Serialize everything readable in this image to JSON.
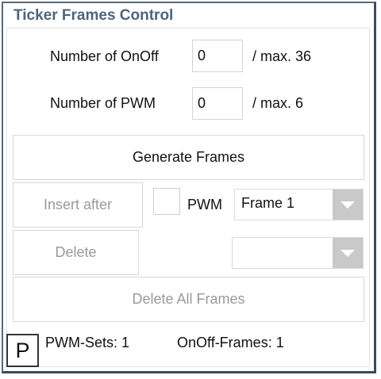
{
  "panel": {
    "title": "Ticker Frames Control"
  },
  "onoff": {
    "label": "Number of OnOff",
    "value": "0",
    "max_label": "/  max. 36"
  },
  "pwm": {
    "label": "Number of PWM",
    "value": "0",
    "max_label": "/   max. 6"
  },
  "buttons": {
    "generate": "Generate Frames",
    "insert_after": "Insert after",
    "delete": "Delete",
    "delete_all": "Delete All Frames"
  },
  "pwm_toggle": {
    "label": "PWM",
    "checked": false
  },
  "frame_select": {
    "selected": "Frame 1"
  },
  "second_select": {
    "selected": ""
  },
  "status": {
    "pwm_sets": "PWM-Sets:  1",
    "onoff_frames": "OnOff-Frames:  1"
  },
  "corner_marker": "P"
}
